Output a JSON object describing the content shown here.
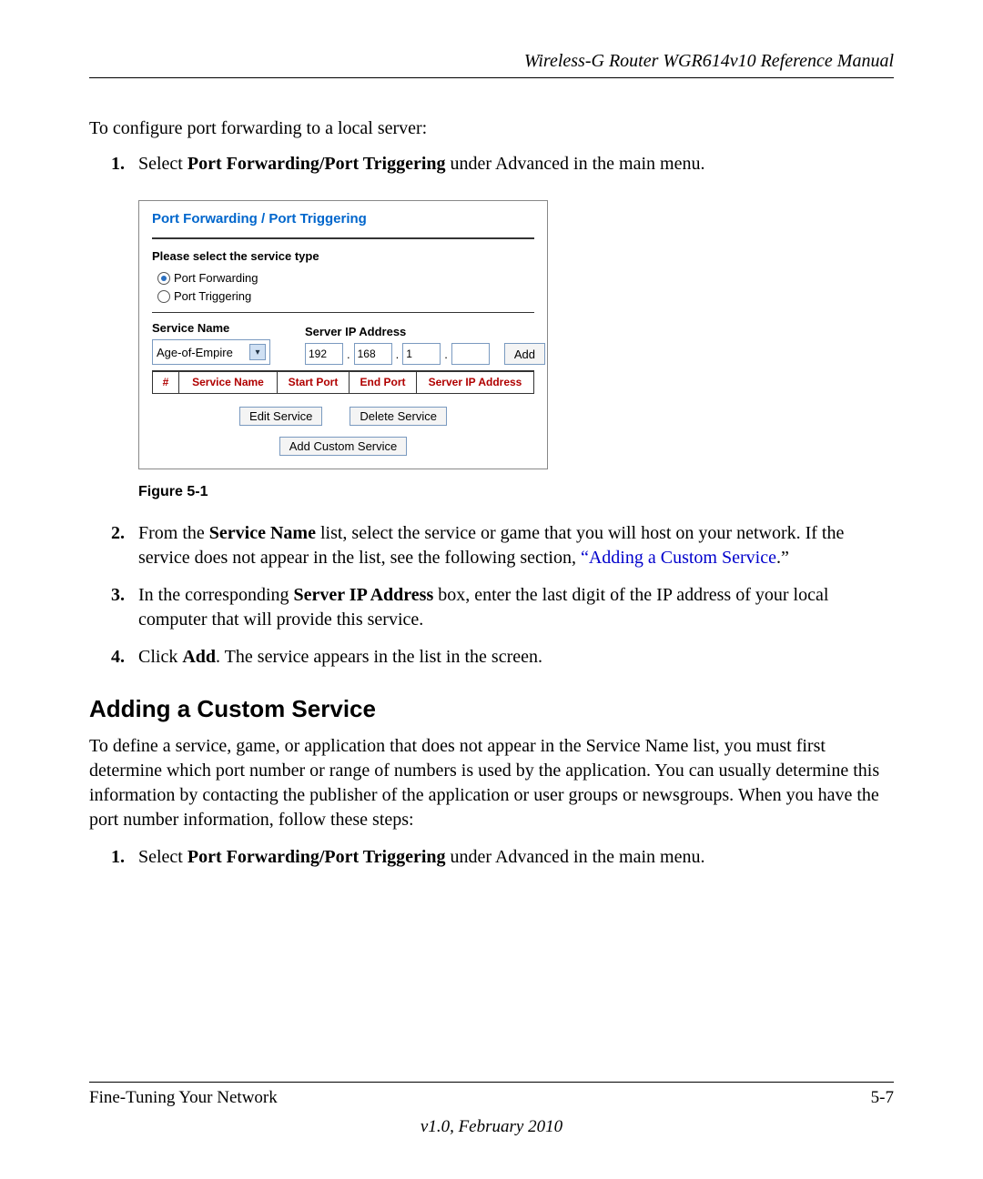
{
  "header": {
    "title": "Wireless-G Router WGR614v10 Reference Manual"
  },
  "intro": "To configure port forwarding to a local server:",
  "steps_top": [
    {
      "pre": "Select ",
      "bold": "Port Forwarding/Port Triggering",
      "post": " under Advanced in the main menu."
    }
  ],
  "figure": {
    "panel_title": "Port Forwarding / Port Triggering",
    "select_label": "Please select the service type",
    "radio_forwarding": "Port Forwarding",
    "radio_triggering": "Port Triggering",
    "service_name_label": "Service Name",
    "server_ip_label": "Server IP Address",
    "service_selected": "Age-of-Empire",
    "ip": {
      "a": "192",
      "b": "168",
      "c": "1",
      "d": ""
    },
    "add_btn": "Add",
    "table_headers": {
      "idx": "#",
      "name": "Service Name",
      "start": "Start Port",
      "end": "End Port",
      "ip": "Server IP Address"
    },
    "edit_btn": "Edit Service",
    "delete_btn": "Delete Service",
    "custom_btn": "Add Custom Service",
    "caption": "Figure 5-1"
  },
  "steps_bottom": [
    {
      "text_before": "From the ",
      "bold1": "Service Name",
      "mid1": " list, select the service or game that you will host on your network. If the service does not appear in the list, see the following section, ",
      "link": "“Adding a Custom Service",
      "after_link": ".”"
    },
    {
      "text_before": "In the corresponding ",
      "bold1": "Server IP Address",
      "mid1": " box, enter the last digit of the IP address of your local computer that will provide this service."
    },
    {
      "text_before": "Click ",
      "bold1": "Add",
      "mid1": ". The service appears in the list in the screen."
    }
  ],
  "section_heading": "Adding a Custom Service",
  "section_para": "To define a service, game, or application that does not appear in the Service Name list, you must first determine which port number or range of numbers is used by the application. You can usually determine this information by contacting the publisher of the application or user groups or newsgroups. When you have the port number information, follow these steps:",
  "steps_section": [
    {
      "pre": "Select ",
      "bold": "Port Forwarding/Port Triggering",
      "post": " under Advanced in the main menu."
    }
  ],
  "footer": {
    "left": "Fine-Tuning Your Network",
    "right": "5-7",
    "version": "v1.0, February 2010"
  }
}
